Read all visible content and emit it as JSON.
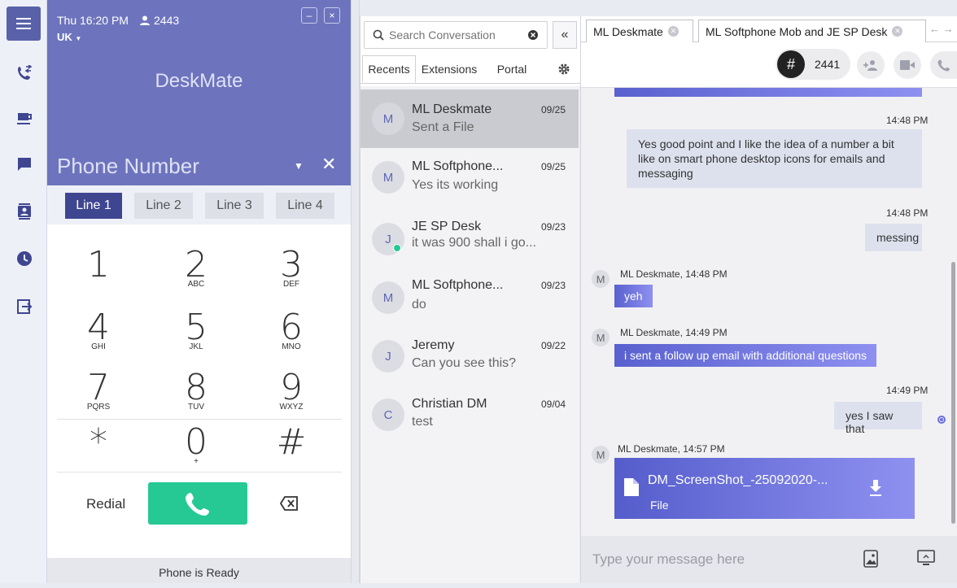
{
  "dialer": {
    "time": "Thu 16:20 PM",
    "extension": "2443",
    "region": "UK",
    "title": "DeskMate",
    "phone_placeholder": "Phone Number",
    "lines": [
      "Line 1",
      "Line 2",
      "Line 3",
      "Line 4"
    ],
    "active_line": "Line 1",
    "keys": [
      {
        "digit": "1",
        "letters": ""
      },
      {
        "digit": "2",
        "letters": "ABC"
      },
      {
        "digit": "3",
        "letters": "DEF"
      },
      {
        "digit": "4",
        "letters": "GHI"
      },
      {
        "digit": "5",
        "letters": "JKL"
      },
      {
        "digit": "6",
        "letters": "MNO"
      },
      {
        "digit": "7",
        "letters": "PQRS"
      },
      {
        "digit": "8",
        "letters": "TUV"
      },
      {
        "digit": "9",
        "letters": "WXYZ"
      },
      {
        "digit": "*",
        "letters": ""
      },
      {
        "digit": "0",
        "letters": "+"
      },
      {
        "digit": "#",
        "letters": ""
      }
    ],
    "redial_label": "Redial",
    "status": "Phone is Ready"
  },
  "conversations": {
    "search_placeholder": "Search Conversation",
    "tabs": [
      "Recents",
      "Extensions",
      "Portal"
    ],
    "active_tab": "Recents",
    "items": [
      {
        "initial": "M",
        "name": "ML Deskmate",
        "date": "09/25",
        "preview": "Sent a File",
        "selected": true,
        "online": false
      },
      {
        "initial": "M",
        "name": "ML Softphone...",
        "date": "09/25",
        "preview": "Yes its working",
        "selected": false,
        "online": false
      },
      {
        "initial": "J",
        "name": "JE SP Desk",
        "date": "09/23",
        "preview": "it was 900 shall i go...",
        "selected": false,
        "online": true
      },
      {
        "initial": "M",
        "name": "ML Softphone...",
        "date": "09/23",
        "preview": "do",
        "selected": false,
        "online": false
      },
      {
        "initial": "J",
        "name": "Jeremy",
        "date": "09/22",
        "preview": "Can you see this?",
        "selected": false,
        "online": false
      },
      {
        "initial": "C",
        "name": "Christian DM",
        "date": "09/04",
        "preview": "test",
        "selected": false,
        "online": false
      }
    ]
  },
  "chat": {
    "tabs": [
      "ML Deskmate",
      "ML Softphone Mob and JE SP Desk"
    ],
    "extension": "2441",
    "messages": {
      "m1_time": "14:48 PM",
      "m1_text": "Yes good point and I like the idea of a number a bit like on smart phone desktop icons for emails and messaging",
      "m2_time": "14:48 PM",
      "m2_text": "messing",
      "m3_sender": "ML Deskmate, 14:48 PM",
      "m3_text": "yeh",
      "m4_sender": "ML Deskmate, 14:49 PM",
      "m4_text": "i sent a follow up email with additional questions",
      "m5_time": "14:49 PM",
      "m5_text": "yes I saw that",
      "m6_sender": "ML Deskmate, 14:57 PM",
      "file_name": "DM_ScreenShot_-25092020-...",
      "file_type": "File"
    },
    "composer_placeholder": "Type your message here"
  },
  "colors": {
    "accent": "#6d74bd",
    "rail_active": "#5961a9",
    "call_green": "#26c994",
    "line_active": "#3f4690"
  }
}
